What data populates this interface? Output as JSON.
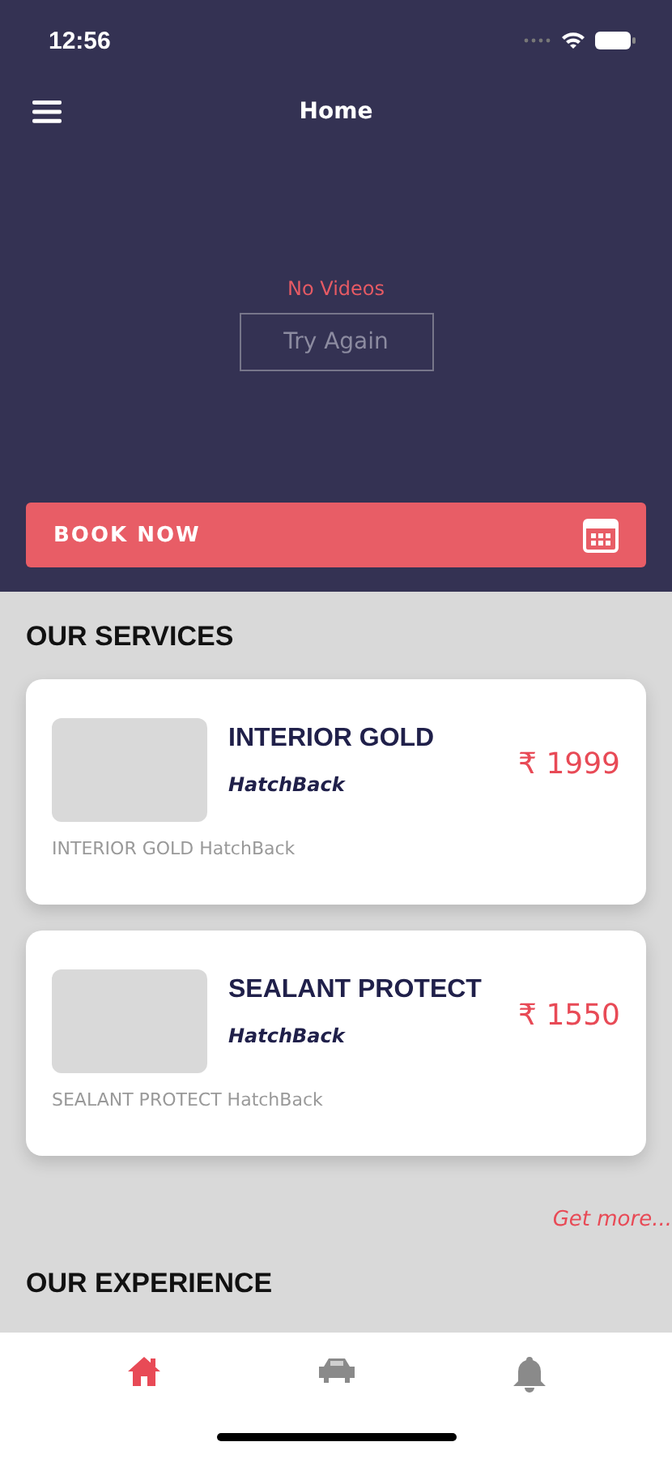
{
  "status_bar": {
    "time": "12:56"
  },
  "header": {
    "title": "Home"
  },
  "video": {
    "message": "No Videos",
    "retry": "Try Again"
  },
  "book_button": {
    "label": "BOOK NOW"
  },
  "services": {
    "title": "OUR SERVICES",
    "items": [
      {
        "name": "INTERIOR GOLD",
        "type": "HatchBack",
        "price": "₹ 1999",
        "description": "INTERIOR GOLD HatchBack"
      },
      {
        "name": "SEALANT PROTECT",
        "type": "HatchBack",
        "price": "₹ 1550",
        "description": "SEALANT PROTECT HatchBack"
      }
    ],
    "more_link": "Get more..."
  },
  "experience": {
    "title": "OUR EXPERIENCE"
  },
  "tab_bar": [
    {
      "kind": "home",
      "selected": true
    },
    {
      "kind": "car",
      "selected": false
    },
    {
      "kind": "bell",
      "selected": false
    }
  ]
}
